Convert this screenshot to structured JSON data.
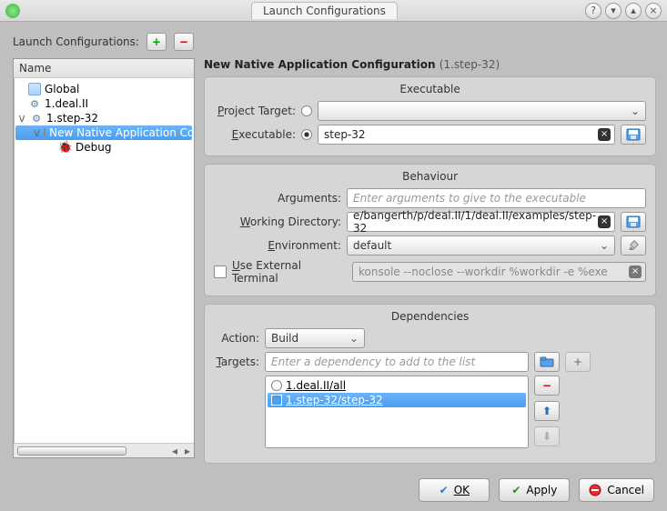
{
  "window": {
    "title": "Launch Configurations"
  },
  "top": {
    "label": "Launch Configurations:"
  },
  "tree": {
    "header": "Name",
    "items": {
      "global": "Global",
      "deal": "1.deal.II",
      "step32": "1.step-32",
      "native": "New Native Application Configuration",
      "debug": "Debug"
    }
  },
  "header": {
    "title": "New Native Application Configuration",
    "sub": "(1.step-32)"
  },
  "exec": {
    "title": "Executable",
    "project_label": "Project Target:",
    "exe_label": "Executable:",
    "exe_value": "step-32"
  },
  "behav": {
    "title": "Behaviour",
    "args_label": "Arguments:",
    "args_ph": "Enter arguments to give to the executable",
    "wd_label": "Working Directory:",
    "wd_value": "e/bangerth/p/deal.II/1/deal.II/examples/step-32",
    "env_label": "Environment:",
    "env_value": "default",
    "ext_label": "Use External Terminal",
    "ext_value": "konsole --noclose --workdir %workdir -e %exe"
  },
  "deps": {
    "title": "Dependencies",
    "action_label": "Action:",
    "action_value": "Build",
    "targets_label": "Targets:",
    "targets_ph": "Enter a dependency to add to the list",
    "list": [
      "1.deal.II/all",
      "1.step-32/step-32"
    ]
  },
  "buttons": {
    "ok": "OK",
    "apply": "Apply",
    "cancel": "Cancel"
  }
}
